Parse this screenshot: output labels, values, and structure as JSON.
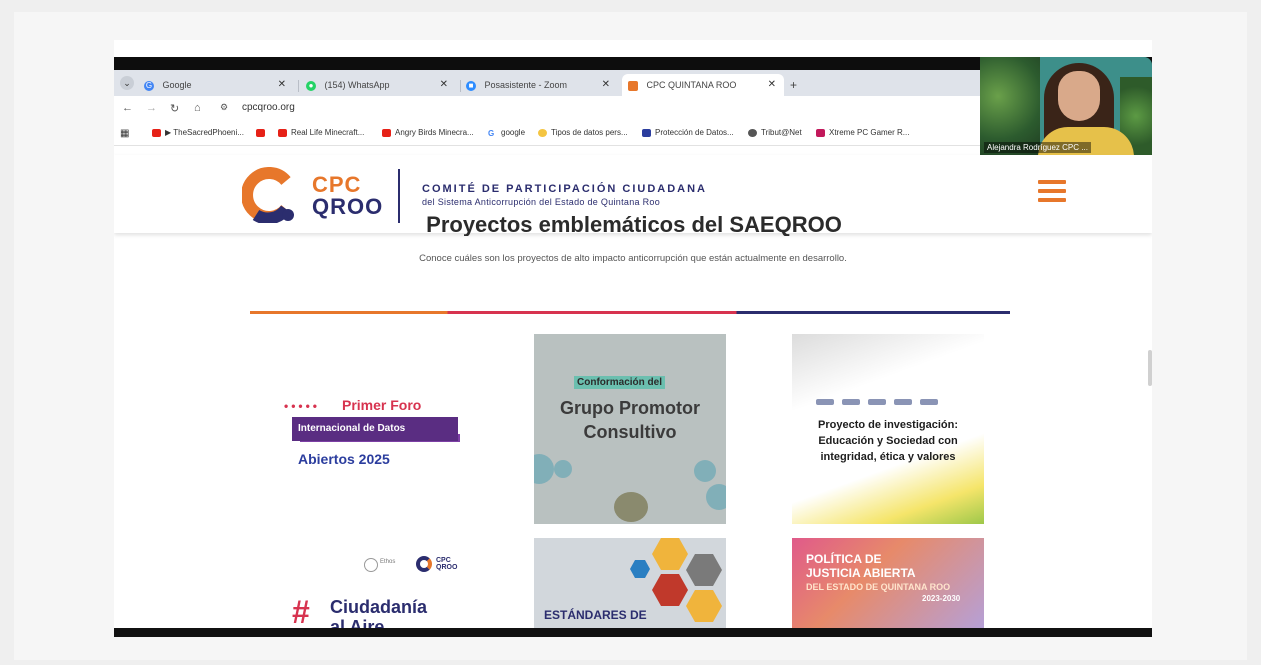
{
  "browser": {
    "tabs": [
      {
        "label": "Google",
        "icon": "google-favicon"
      },
      {
        "label": "(154) WhatsApp",
        "icon": "whatsapp-favicon"
      },
      {
        "label": "Posasistente - Zoom",
        "icon": "zoom-favicon"
      },
      {
        "label": "CPC QUINTANA ROO",
        "icon": "cpc-favicon",
        "active": true
      }
    ],
    "url": "cpcqroo.org",
    "bookmarks": [
      "▶ TheSacredPhoeni...",
      "Real Life Minecraft...",
      "Angry Birds Minecra...",
      "google",
      "Tipos de datos pers...",
      "Protección de Datos...",
      "Tribut@Net",
      "Xtreme PC Gamer R..."
    ]
  },
  "webcam": {
    "name": "Alejandra Rodríguez CPC ..."
  },
  "site": {
    "logo_top": "CPC",
    "logo_bottom": "QROO",
    "title": "COMITÉ DE PARTICIPACIÓN CIUDADANA",
    "subtitle": "del Sistema Anticorrupción del Estado de Quintana Roo",
    "section_heading": "Proyectos emblemáticos del SAEQROO",
    "section_subtitle": "Conoce cuáles son los proyectos de alto impacto anticorrupción que están actualmente en desarrollo.",
    "colors": {
      "orange": "#e7772b",
      "red": "#d7334f",
      "navy": "#2b2d6e"
    }
  },
  "cards": {
    "c1": {
      "line1": "Primer Foro",
      "line2": "Internacional de Datos",
      "line3": "Abiertos 2025"
    },
    "c2": {
      "tag": "Conformación del",
      "line1": "Grupo Promotor",
      "line2": "Consultivo"
    },
    "c3": {
      "text": "Proyecto de investigación: Educación y Sociedad con integridad, ética y valores"
    },
    "c4": {
      "hash": "#",
      "line1": "Ciudadanía",
      "line2": "al Aire",
      "logo": "CPC QROO"
    },
    "c5": {
      "line1": "ESTÁNDARES DE"
    },
    "c6": {
      "line1": "POLÍTICA DE",
      "line2": "JUSTICIA ABIERTA",
      "line3": "DEL ESTADO DE QUINTANA ROO",
      "line4": "2023-2030"
    }
  }
}
